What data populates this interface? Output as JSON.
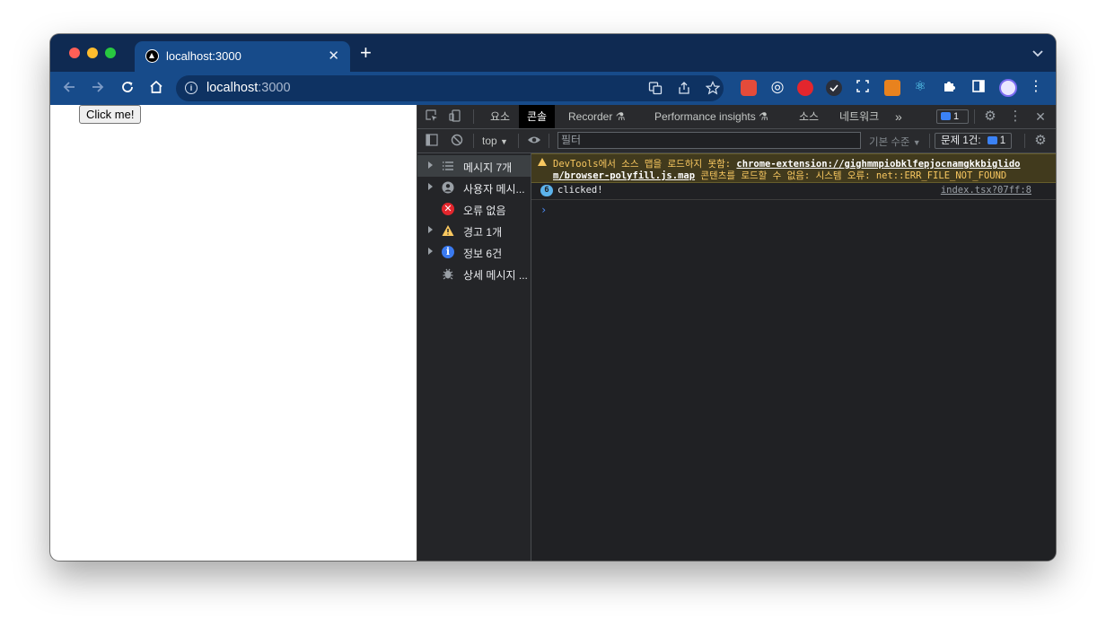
{
  "browser": {
    "tab_title": "localhost:3000",
    "tab_close": "✕",
    "new_tab": "+",
    "url_host": "localhost",
    "url_port": ":3000"
  },
  "page": {
    "button_label": "Click me!"
  },
  "devtools": {
    "tabs": [
      "요소",
      "콘솔",
      "Recorder",
      "Performance insights",
      "소스",
      "네트워크"
    ],
    "active_tab": "콘솔",
    "more_tabs": "»",
    "issues_badge": "1",
    "context": "top",
    "filter_placeholder": "필터",
    "levels_label": "기본 수준",
    "issues_label": "문제 1건:",
    "issues_count": "1",
    "sidebar": [
      {
        "label": "메시지 7개",
        "icon": "list-icon",
        "expandable": true,
        "selected": true
      },
      {
        "label": "사용자 메시...",
        "icon": "user-icon",
        "expandable": true,
        "selected": false
      },
      {
        "label": "오류 없음",
        "icon": "error-icon",
        "expandable": false,
        "selected": false
      },
      {
        "label": "경고 1개",
        "icon": "warning-icon",
        "expandable": true,
        "selected": false
      },
      {
        "label": "정보 6건",
        "icon": "info-icon",
        "expandable": true,
        "selected": false
      },
      {
        "label": "상세 메시지 ...",
        "icon": "bug-icon",
        "expandable": false,
        "selected": false
      }
    ],
    "console": {
      "warning": {
        "prefix": "DevTools에서 소스 맵을 로드하지 못함: ",
        "link1": "chrome-extension://gighmmpiobklfepjocnamgkkbiglido",
        "link2": "m/browser-polyfill.js.map",
        "suffix": " 콘텐츠를 로드할 수 없음: 시스템 오류: net::ERR_FILE_NOT_FOUND"
      },
      "log": {
        "count": "6",
        "text": "clicked!",
        "source": "index.tsx?07ff:8"
      },
      "prompt": "›"
    }
  }
}
